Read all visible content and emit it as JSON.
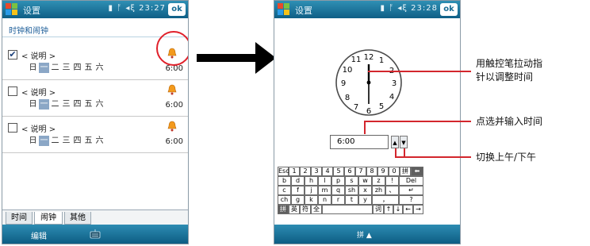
{
  "screen1": {
    "titlebar": {
      "title": "设置",
      "status": "▮ ᚩ ◂ξ 23:27",
      "ok_label": "ok"
    },
    "subheader": "时钟和闹钟",
    "alarms": [
      {
        "checked": true,
        "checkmark": "✔",
        "description": "< 说明 >",
        "days": [
          "日",
          "一",
          "二",
          "三",
          "四",
          "五",
          "六"
        ],
        "highlighted_day_index": 1,
        "time": "6:00"
      },
      {
        "checked": false,
        "checkmark": "",
        "description": "< 说明 >",
        "days": [
          "日",
          "一",
          "二",
          "三",
          "四",
          "五",
          "六"
        ],
        "highlighted_day_index": 1,
        "time": "6:00"
      },
      {
        "checked": false,
        "checkmark": "",
        "description": "< 说明 >",
        "days": [
          "日",
          "一",
          "二",
          "三",
          "四",
          "五",
          "六"
        ],
        "highlighted_day_index": 1,
        "time": "6:00"
      }
    ],
    "tabs": [
      "时间",
      "闹钟",
      "其他"
    ],
    "active_tab_index": 1,
    "softkey_left": "编辑"
  },
  "screen2": {
    "titlebar": {
      "title": "设置",
      "status": "▮ ᚩ ◂ξ 23:28",
      "ok_label": "ok"
    },
    "clock": {
      "numbers": [
        "12",
        "11",
        "1",
        "10",
        "2",
        "9",
        "3",
        "8",
        "4",
        "7",
        "5",
        "6"
      ],
      "hour": 12,
      "minute": 30
    },
    "time_field": "6:00",
    "spin_up": "▲",
    "spin_down": "▼",
    "keyboard": {
      "rows": [
        [
          "Esc",
          "1",
          "2",
          "3",
          "4",
          "5",
          "6",
          "7",
          "8",
          "9",
          "0",
          "拼",
          "⬅"
        ],
        [
          "b",
          "d",
          "h",
          "l",
          "p",
          "s",
          "w",
          "z",
          "!",
          "Del"
        ],
        [
          "c",
          "f",
          "j",
          "m",
          "q",
          "sh",
          "x",
          "zh",
          "、",
          "↵"
        ],
        [
          "ch",
          "g",
          "k",
          "n",
          "r",
          "t",
          "y",
          "，",
          "?"
        ],
        [
          "拼",
          "英",
          "符",
          "全",
          "",
          "词",
          "↑",
          "↓",
          "←",
          "→"
        ]
      ]
    },
    "softkey_center": "拼 ▲"
  },
  "callouts": [
    {
      "text_line1": "用触控笔拉动指",
      "text_line2": "针以调整时间"
    },
    {
      "text_line1": "点选并输入时间"
    },
    {
      "text_line1": "切换上午/下午"
    }
  ],
  "colors": {
    "titlebar_top": "#2f8fb4",
    "titlebar_bottom": "#0f5f86",
    "callout_red": "#d3262d",
    "circle_red": "#e0202a"
  }
}
